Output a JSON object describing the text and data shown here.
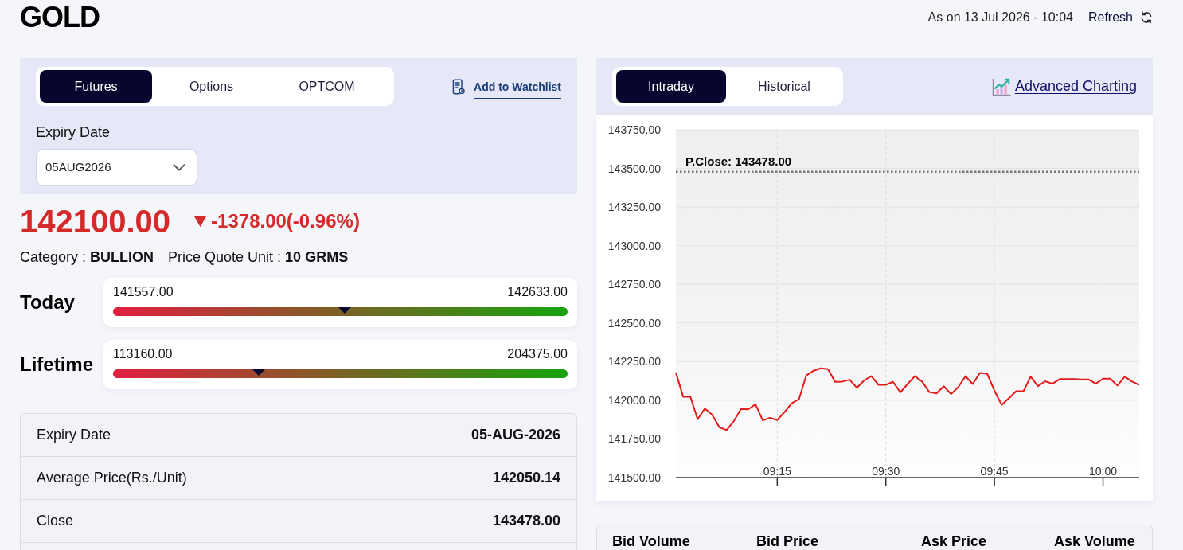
{
  "header": {
    "title": "GOLD",
    "timestamp": "As on 13 Jul 2026 - 10:04",
    "refresh": "Refresh"
  },
  "contract_panel": {
    "tabs": [
      {
        "label": "Futures",
        "selected": true
      },
      {
        "label": "Options",
        "selected": false
      },
      {
        "label": "OPTCOM",
        "selected": false
      }
    ],
    "watchlist_link": "Add to Watchlist",
    "expiry_label": "Expiry Date",
    "expiry_value": "05AUG2026"
  },
  "quote": {
    "price": "142100.00",
    "negative": true,
    "change": "-1378.00(-0.96%)",
    "details": [
      "Category : **BULLION**",
      "Price Quote Unit : **10 GRMS**"
    ]
  },
  "ranges": [
    {
      "label": "Today",
      "low": "141557.00",
      "high": "142633.00",
      "level": 0.51
    },
    {
      "label": "Lifetime",
      "low": "113160.00",
      "high": "204375.00",
      "level": 0.32
    }
  ],
  "info_table": {
    "rows": [
      {
        "label": "Expiry Date",
        "value": "05-AUG-2026"
      },
      {
        "label": "Average Price(Rs./Unit)",
        "value": "142050.14"
      },
      {
        "label": "Close",
        "value": "143478.00"
      }
    ]
  },
  "chart_panel": {
    "tabs": [
      {
        "label": "Intraday",
        "selected": true
      },
      {
        "label": "Historical",
        "selected": false
      }
    ],
    "advanced_link": "Advanced Charting",
    "chart_data": {
      "type": "line",
      "categories": [
        null,
        null,
        null,
        null,
        null,
        null,
        null,
        null,
        null,
        null,
        null,
        null,
        null,
        null,
        "09:15",
        null,
        null,
        null,
        null,
        null,
        null,
        null,
        null,
        null,
        null,
        null,
        null,
        null,
        null,
        "09:30",
        null,
        null,
        null,
        null,
        null,
        null,
        null,
        null,
        null,
        null,
        null,
        null,
        null,
        null,
        "09:45",
        null,
        null,
        null,
        null,
        null,
        null,
        null,
        null,
        null,
        null,
        null,
        null,
        null,
        null,
        "10:00",
        null,
        null,
        null,
        null,
        null
      ],
      "series": [
        {
          "color": "#e41b1b",
          "values": [
            142179,
            142023,
            142023,
            141877,
            141947,
            141907,
            141826,
            141807,
            141865,
            141944,
            141942,
            141974,
            141870,
            141886,
            141872,
            141923,
            141981,
            142007,
            142160,
            142191,
            142207,
            142202,
            142119,
            142121,
            142133,
            142081,
            142128,
            142156,
            142100,
            142100,
            142119,
            142051,
            142105,
            142156,
            142121,
            142053,
            142044,
            142091,
            142040,
            142086,
            142156,
            142105,
            142177,
            142172,
            142063,
            141970,
            142014,
            142058,
            142058,
            142153,
            142091,
            142123,
            142107,
            142137,
            142137,
            142137,
            142135,
            142135,
            142107,
            142140,
            142140,
            142095,
            142153,
            142121,
            142100
          ]
        }
      ],
      "ylim": [
        141500,
        143750
      ],
      "yticks": [
        {
          "value": 141500,
          "label": "141500.00"
        },
        {
          "value": 141750,
          "label": "141750.00"
        },
        {
          "value": 142000,
          "label": "142000.00"
        },
        {
          "value": 142250,
          "label": "142250.00"
        },
        {
          "value": 142500,
          "label": "142500.00"
        },
        {
          "value": 142750,
          "label": "142750.00"
        },
        {
          "value": 143000,
          "label": "143000.00"
        },
        {
          "value": 143250,
          "label": "143250.00"
        },
        {
          "value": 143500,
          "label": "143500.00"
        },
        {
          "value": 143750,
          "label": "143750.00"
        }
      ],
      "grid": true,
      "ref_lines": [
        {
          "axis": "y",
          "value": 143478
        }
      ],
      "annotations": [
        "P.Close: 143478.00"
      ]
    }
  },
  "order_book": {
    "columns": [
      "Bid Volume",
      "Bid Price",
      "Ask Price",
      "Ask Volume"
    ]
  }
}
